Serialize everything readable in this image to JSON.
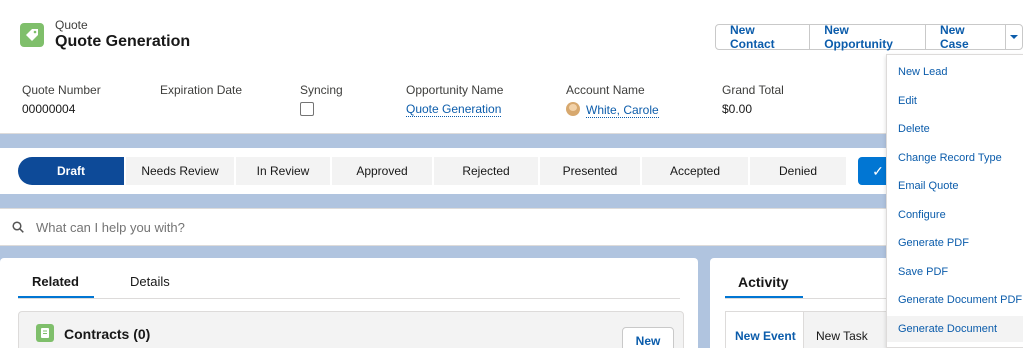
{
  "header": {
    "object_label": "Quote",
    "record_title": "Quote Generation",
    "buttons": [
      "New Contact",
      "New Opportunity",
      "New Case"
    ],
    "more_icon": "chevron-down-icon"
  },
  "fields": {
    "quote_number": {
      "label": "Quote Number",
      "value": "00000004"
    },
    "expiration_date": {
      "label": "Expiration Date",
      "value": ""
    },
    "syncing": {
      "label": "Syncing",
      "checked": false
    },
    "opportunity_name": {
      "label": "Opportunity Name",
      "value": "Quote Generation"
    },
    "account_name": {
      "label": "Account Name",
      "value": "White, Carole"
    },
    "grand_total": {
      "label": "Grand Total",
      "value": "$0.00"
    }
  },
  "path": {
    "steps": [
      "Draft",
      "Needs Review",
      "In Review",
      "Approved",
      "Rejected",
      "Presented",
      "Accepted",
      "Denied"
    ],
    "current": "Draft"
  },
  "search": {
    "placeholder": "What can I help you with?"
  },
  "left_tabs": {
    "related": "Related",
    "details": "Details"
  },
  "contracts_card": {
    "title": "Contracts (0)",
    "new_button": "New"
  },
  "activity": {
    "tab": "Activity",
    "new_event": "New Event",
    "new_task": "New Task"
  },
  "dropdown": {
    "items": [
      "New Lead",
      "Edit",
      "Delete",
      "Change Record Type",
      "Email Quote",
      "Configure",
      "Generate PDF",
      "Save PDF",
      "Generate Document PDF",
      "Generate Document"
    ],
    "highlighted": "Generate Document"
  },
  "colors": {
    "brand": "#0176d3",
    "path_current": "#0d4a98",
    "link": "#0b5cab",
    "quote_icon": "#7fbf6b"
  }
}
